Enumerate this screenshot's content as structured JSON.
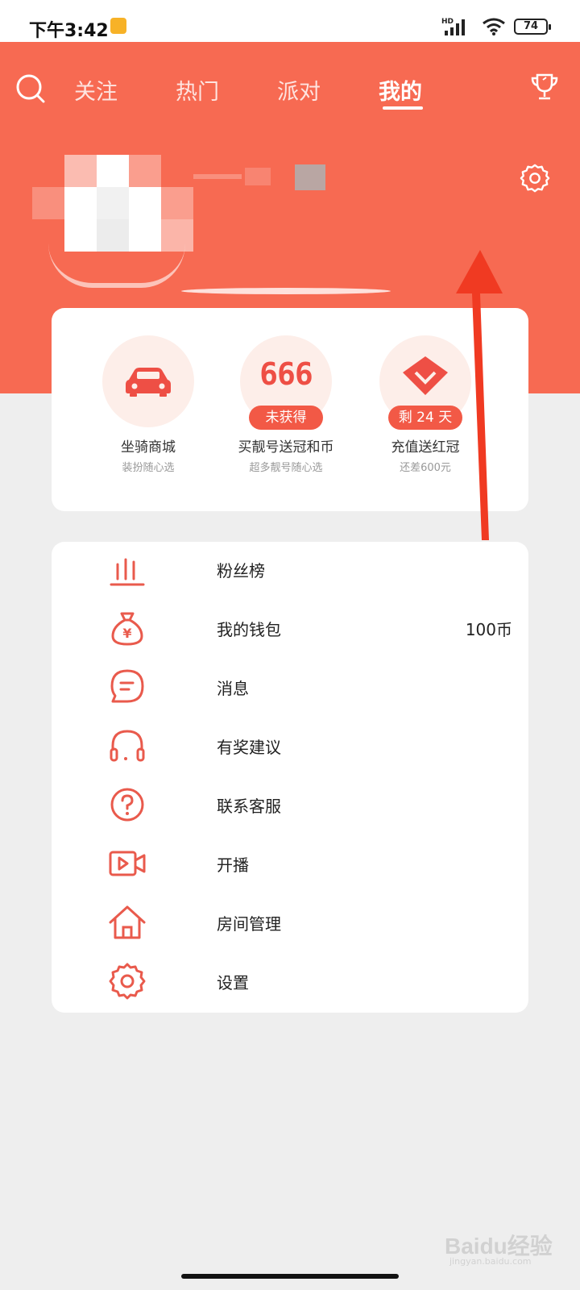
{
  "status_bar": {
    "time": "下午3:42",
    "network": "HD",
    "battery": "74"
  },
  "header": {
    "tabs": [
      {
        "label": "关注",
        "active": false
      },
      {
        "label": "热门",
        "active": false
      },
      {
        "label": "派对",
        "active": false
      },
      {
        "label": "我的",
        "active": true
      }
    ],
    "icons": {
      "search": "search-icon",
      "trophy": "trophy-icon",
      "settings": "gear-icon"
    }
  },
  "shortcuts": [
    {
      "title": "坐骑商城",
      "subtitle": "装扮随心选",
      "icon": "car-icon",
      "badge": ""
    },
    {
      "title": "买靓号送冠和币",
      "subtitle": "超多靓号随心选",
      "icon": "666-icon",
      "icon_text": "666",
      "badge": "未获得"
    },
    {
      "title": "充值送红冠",
      "subtitle": "还差600元",
      "icon": "diamond-icon",
      "badge": "剩 24 天"
    }
  ],
  "menu": [
    {
      "label": "粉丝榜",
      "icon": "ranking-icon",
      "value": ""
    },
    {
      "label": "我的钱包",
      "icon": "money-bag-icon",
      "value": "100币"
    },
    {
      "label": "消息",
      "icon": "message-icon",
      "value": ""
    },
    {
      "label": "有奖建议",
      "icon": "headset-icon",
      "value": ""
    },
    {
      "label": "联系客服",
      "icon": "help-icon",
      "value": ""
    },
    {
      "label": "开播",
      "icon": "video-icon",
      "value": ""
    },
    {
      "label": "房间管理",
      "icon": "home-icon",
      "value": ""
    },
    {
      "label": "设置",
      "icon": "gear-icon",
      "value": ""
    }
  ],
  "watermark": {
    "text": "Baidu经验",
    "sub": "jingyan.baidu.com"
  },
  "colors": {
    "accent": "#f76a52",
    "icon": "#e95a4c",
    "badge": "#f25946",
    "background": "#eeeeee"
  }
}
